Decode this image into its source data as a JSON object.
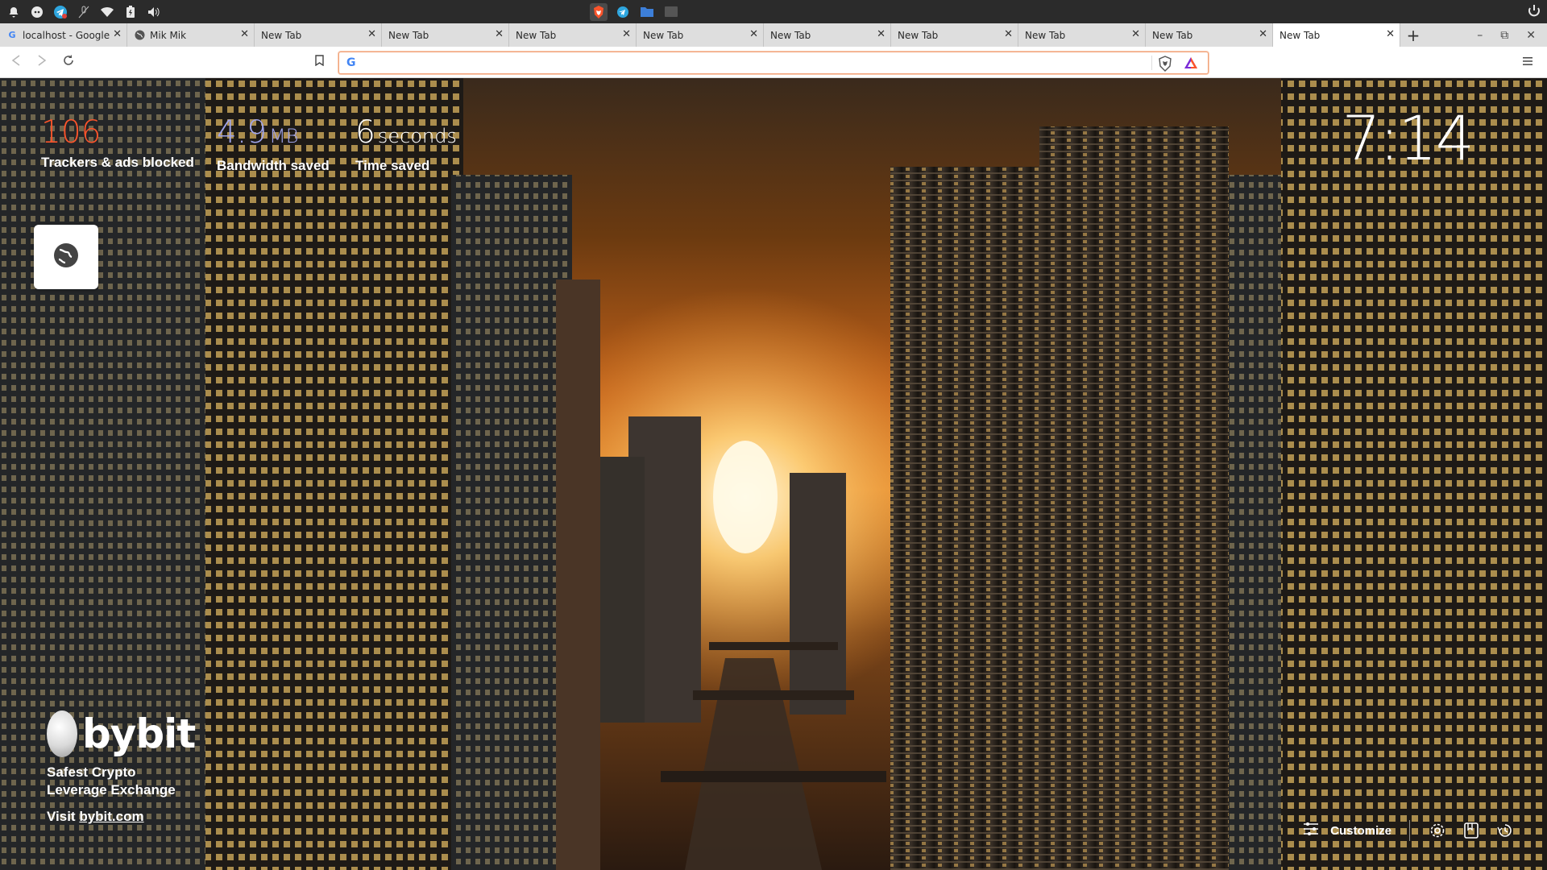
{
  "system_bar": {
    "left_icons": [
      "bell-icon",
      "discord-icon",
      "telegram-icon",
      "mic-off-icon",
      "wifi-icon",
      "battery-icon",
      "volume-icon"
    ],
    "apps": [
      "brave-icon",
      "telegram-icon",
      "folder-icon",
      "terminal-icon"
    ],
    "right_icon": "power-icon"
  },
  "tabs": [
    {
      "title": "localhost - Google",
      "favicon": "G",
      "active": false
    },
    {
      "title": "Mik Mik",
      "favicon": "globe",
      "active": false
    },
    {
      "title": "New Tab",
      "active": false
    },
    {
      "title": "New Tab",
      "active": false
    },
    {
      "title": "New Tab",
      "active": false
    },
    {
      "title": "New Tab",
      "active": false
    },
    {
      "title": "New Tab",
      "active": false
    },
    {
      "title": "New Tab",
      "active": false
    },
    {
      "title": "New Tab",
      "active": false
    },
    {
      "title": "New Tab",
      "active": false
    },
    {
      "title": "New Tab",
      "active": true
    }
  ],
  "toolbar": {
    "omnibox_value": "",
    "omnibox_placeholder": ""
  },
  "stats": {
    "trackers": {
      "value": "106",
      "label": "Trackers & ads blocked",
      "color": "#fb542b"
    },
    "bandwidth": {
      "value": "4.9",
      "unit": "MB",
      "label": "Bandwidth saved",
      "color": "#a0a5eb"
    },
    "time": {
      "value": "6",
      "unit": "seconds",
      "label": "Time saved",
      "color": "#ffffff"
    }
  },
  "clock": "7:14",
  "sponsor": {
    "brand": "bybit",
    "tagline_1": "Safest Crypto",
    "tagline_2": "Leverage Exchange",
    "visit_prefix": "Visit ",
    "visit_link": "bybit.com"
  },
  "bottom": {
    "customize_label": "Customize"
  }
}
